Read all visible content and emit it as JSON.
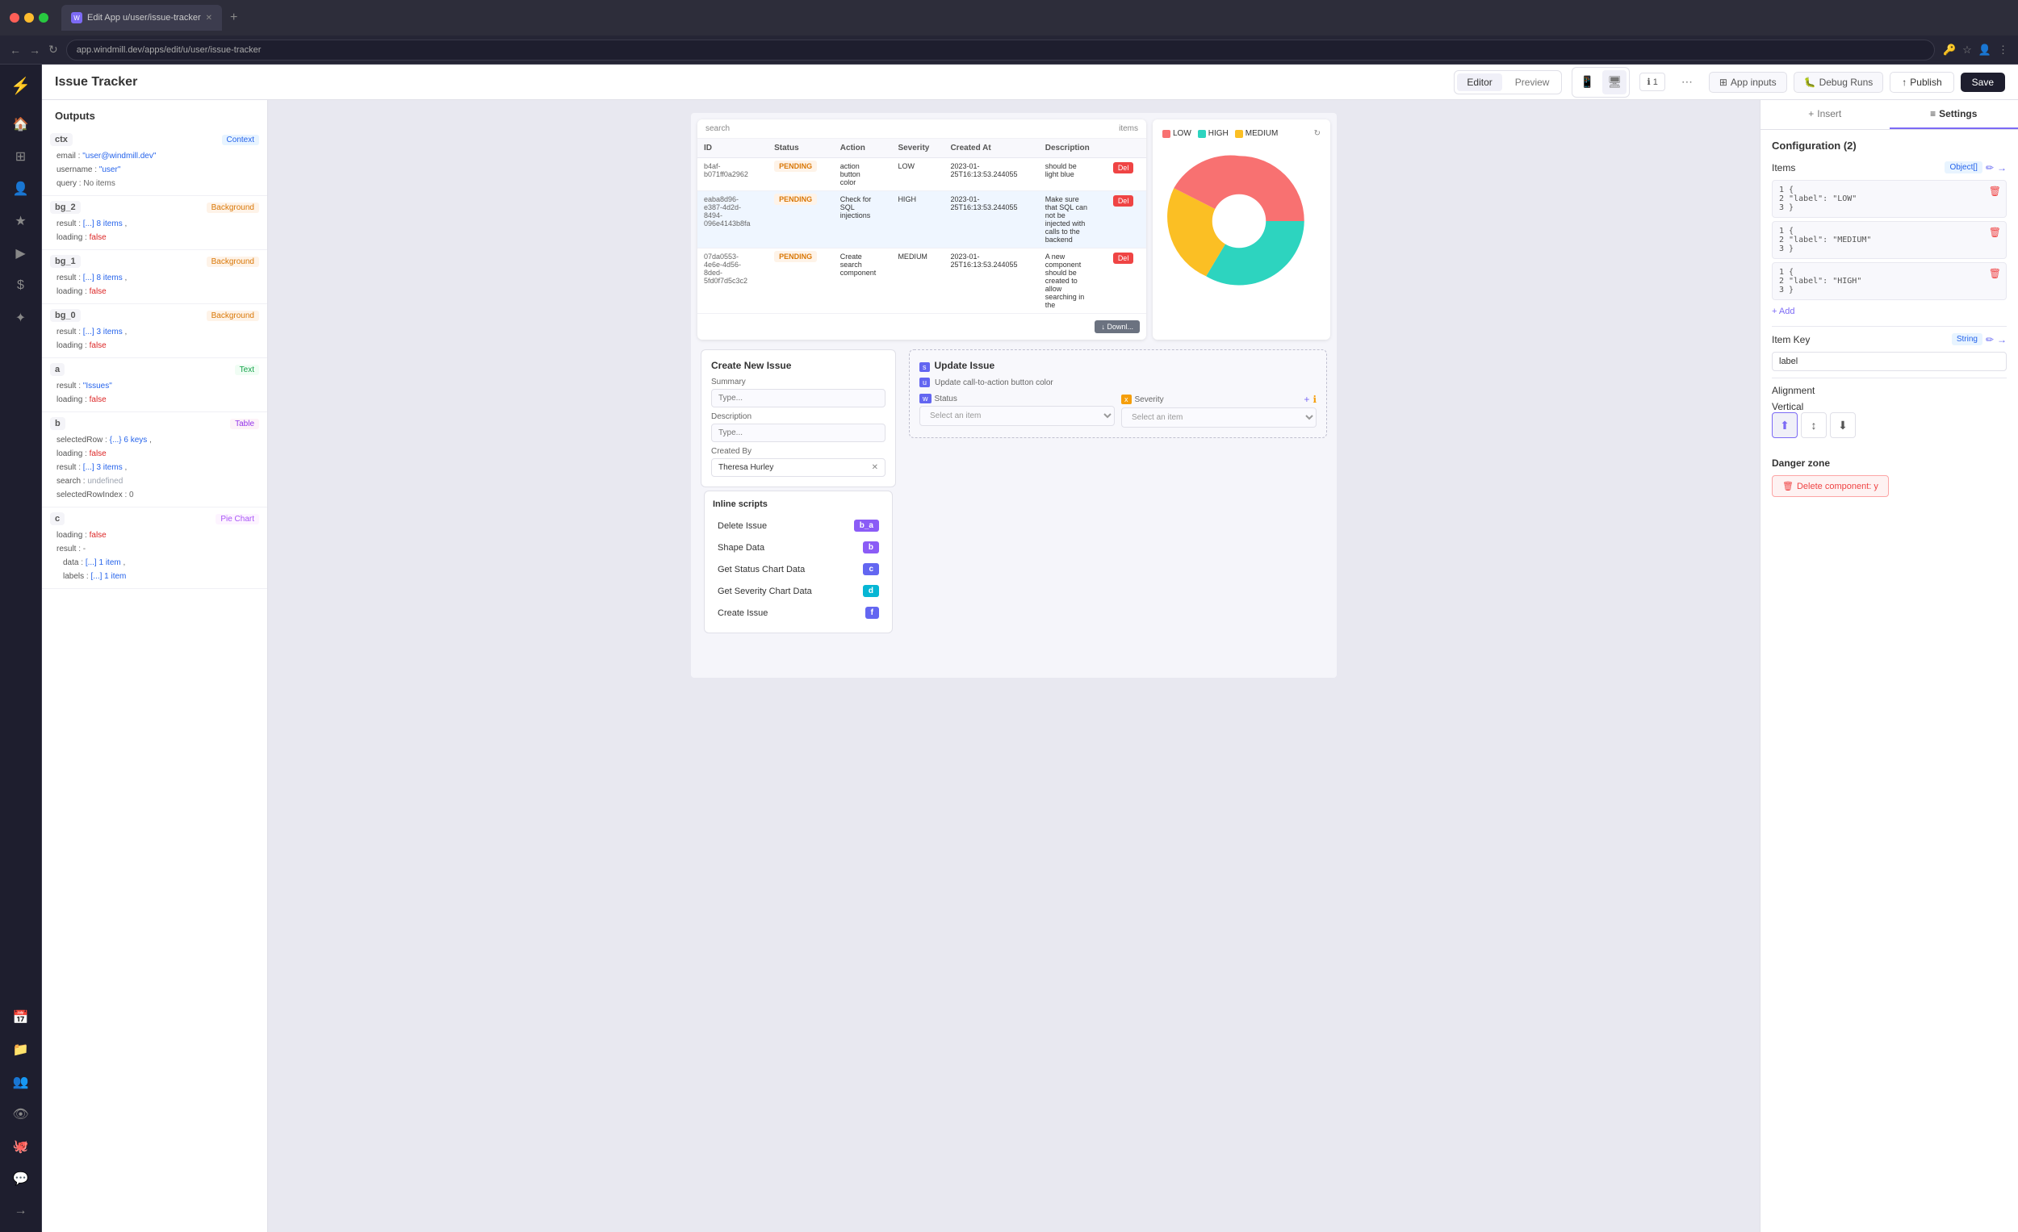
{
  "browser": {
    "tab_label": "Edit App u/user/issue-tracker",
    "url": "app.windmill.dev/apps/edit/u/user/issue-tracker",
    "new_tab_label": "+"
  },
  "toolbar": {
    "app_title": "Issue Tracker",
    "editor_btn": "Editor",
    "preview_btn": "Preview",
    "app_inputs_btn": "App inputs",
    "debug_runs_btn": "Debug Runs",
    "publish_btn": "Publish",
    "save_btn": "Save"
  },
  "outputs_panel": {
    "title": "Outputs",
    "groups": [
      {
        "var": "ctx",
        "badge": "Context",
        "props": [
          {
            "key": "email",
            "val": "\"user@windmill.dev\"",
            "type": "string"
          },
          {
            "key": "username",
            "val": "\"user\"",
            "type": "string"
          },
          {
            "key": "query",
            "val": "No items",
            "type": "normal"
          }
        ]
      },
      {
        "var": "bg_2",
        "badge": "Background",
        "props": [
          {
            "key": "result",
            "val": "[...] 8 items",
            "type": "array"
          },
          {
            "key": "loading",
            "val": "false",
            "type": "bool"
          }
        ]
      },
      {
        "var": "bg_1",
        "badge": "Background",
        "props": [
          {
            "key": "result",
            "val": "[...] 8 items",
            "type": "array"
          },
          {
            "key": "loading",
            "val": "false",
            "type": "bool"
          }
        ]
      },
      {
        "var": "bg_0",
        "badge": "Background",
        "props": [
          {
            "key": "result",
            "val": "[...] 3 items",
            "type": "array"
          },
          {
            "key": "loading",
            "val": "false",
            "type": "bool"
          }
        ]
      },
      {
        "var": "a",
        "badge": "Text",
        "props": [
          {
            "key": "result",
            "val": "\"Issues\"",
            "type": "string"
          },
          {
            "key": "loading",
            "val": "false",
            "type": "bool"
          }
        ]
      },
      {
        "var": "b",
        "badge": "Table",
        "props": [
          {
            "key": "selectedRow",
            "val": "{...} 6 keys",
            "type": "obj"
          },
          {
            "key": "loading",
            "val": "false",
            "type": "bool"
          },
          {
            "key": "result",
            "val": "[...] 3 items",
            "type": "array"
          },
          {
            "key": "search",
            "val": "undefined",
            "type": "undef"
          },
          {
            "key": "selectedRowIndex",
            "val": "0",
            "type": "normal"
          }
        ]
      },
      {
        "var": "c",
        "badge": "Pie Chart",
        "props": [
          {
            "key": "loading",
            "val": "false",
            "type": "bool"
          },
          {
            "key": "result",
            "val": "-",
            "type": "normal"
          },
          {
            "key": "data",
            "val": "[...] 1 item",
            "type": "array"
          },
          {
            "key": "labels",
            "val": "[...] 1 item",
            "type": "array"
          }
        ]
      }
    ]
  },
  "canvas": {
    "table": {
      "columns": [
        "ID",
        "Status",
        "Action",
        "Severity",
        "Created At",
        "Description",
        ""
      ],
      "rows": [
        {
          "id": "b4af-b071ff0a2962",
          "status": "PENDING",
          "action": "action button color",
          "severity": "LOW",
          "created_at": "2023-01-25T16:13:53.244055",
          "description": "should be light blue",
          "del": "Del"
        },
        {
          "id": "eaba8d96-e387-4d2d-8494-096e4143b8fa",
          "status": "PENDING",
          "action": "Check for SQL injections",
          "severity": "HIGH",
          "created_at": "2023-01-25T16:13:53.244055",
          "description": "Make sure that SQL can not be injected with calls to the backend",
          "del": "Del"
        },
        {
          "id": "07da0553-4e6e-4d56-8ded-5fd0f7d5c3c2",
          "status": "PENDING",
          "action": "Create search component",
          "severity": "MEDIUM",
          "created_at": "2023-01-25T16:13:53.244055",
          "description": "A new component should be created to allow searching in the",
          "del": "Del"
        }
      ],
      "search_placeholder": "search",
      "items_count": "items",
      "download_btn": "↓ Downl..."
    },
    "pie_chart": {
      "legend": [
        {
          "label": "LOW",
          "color": "#f87171"
        },
        {
          "label": "HIGH",
          "color": "#2dd4bf"
        },
        {
          "label": "MEDIUM",
          "color": "#fbbf24"
        }
      ]
    },
    "create_issue": {
      "title": "Create New Issue",
      "summary_label": "Summary",
      "summary_placeholder": "Type...",
      "description_label": "Description",
      "description_placeholder": "Type...",
      "created_by_label": "Created By",
      "created_by_value": "Theresa Hurley"
    },
    "update_issue": {
      "title": "Update Issue",
      "subtitle": "Update call-to-action button color",
      "status_label": "Status",
      "severity_label": "Severity",
      "status_placeholder": "Select an item",
      "severity_placeholder": "Select an item"
    },
    "inline_scripts": {
      "title": "Inline scripts",
      "scripts": [
        {
          "name": "Delete Issue",
          "badge": "b_a",
          "badge_class": "badge-b-a"
        },
        {
          "name": "Shape Data",
          "badge": "b",
          "badge_class": "badge-b"
        },
        {
          "name": "Get Status Chart Data",
          "badge": "c",
          "badge_class": "badge-c"
        },
        {
          "name": "Get Severity Chart Data",
          "badge": "d",
          "badge_class": "badge-d"
        },
        {
          "name": "Create Issue",
          "badge": "f",
          "badge_class": "badge-f"
        }
      ]
    }
  },
  "config_panel": {
    "insert_tab": "Insert",
    "settings_tab": "Settings",
    "section_title": "Configuration (2)",
    "items_label": "Items",
    "items_type": "Object[]",
    "items": [
      {
        "line1": "1  {",
        "line2": "2    \"label\": \"LOW\"",
        "line3": "3  }"
      },
      {
        "line1": "1  {",
        "line2": "2    \"label\": \"MEDIUM\"",
        "line3": "3  }"
      },
      {
        "line1": "1  {",
        "line2": "2    \"label\": \"HIGH\"",
        "line3": "3  }"
      }
    ],
    "add_btn": "+ Add",
    "item_key_label": "Item Key",
    "item_key_type": "String",
    "item_key_value": "label",
    "alignment_label": "Alignment",
    "vertical_label": "Vertical",
    "danger_zone_title": "Danger zone",
    "delete_component_btn": "Delete component: y"
  }
}
